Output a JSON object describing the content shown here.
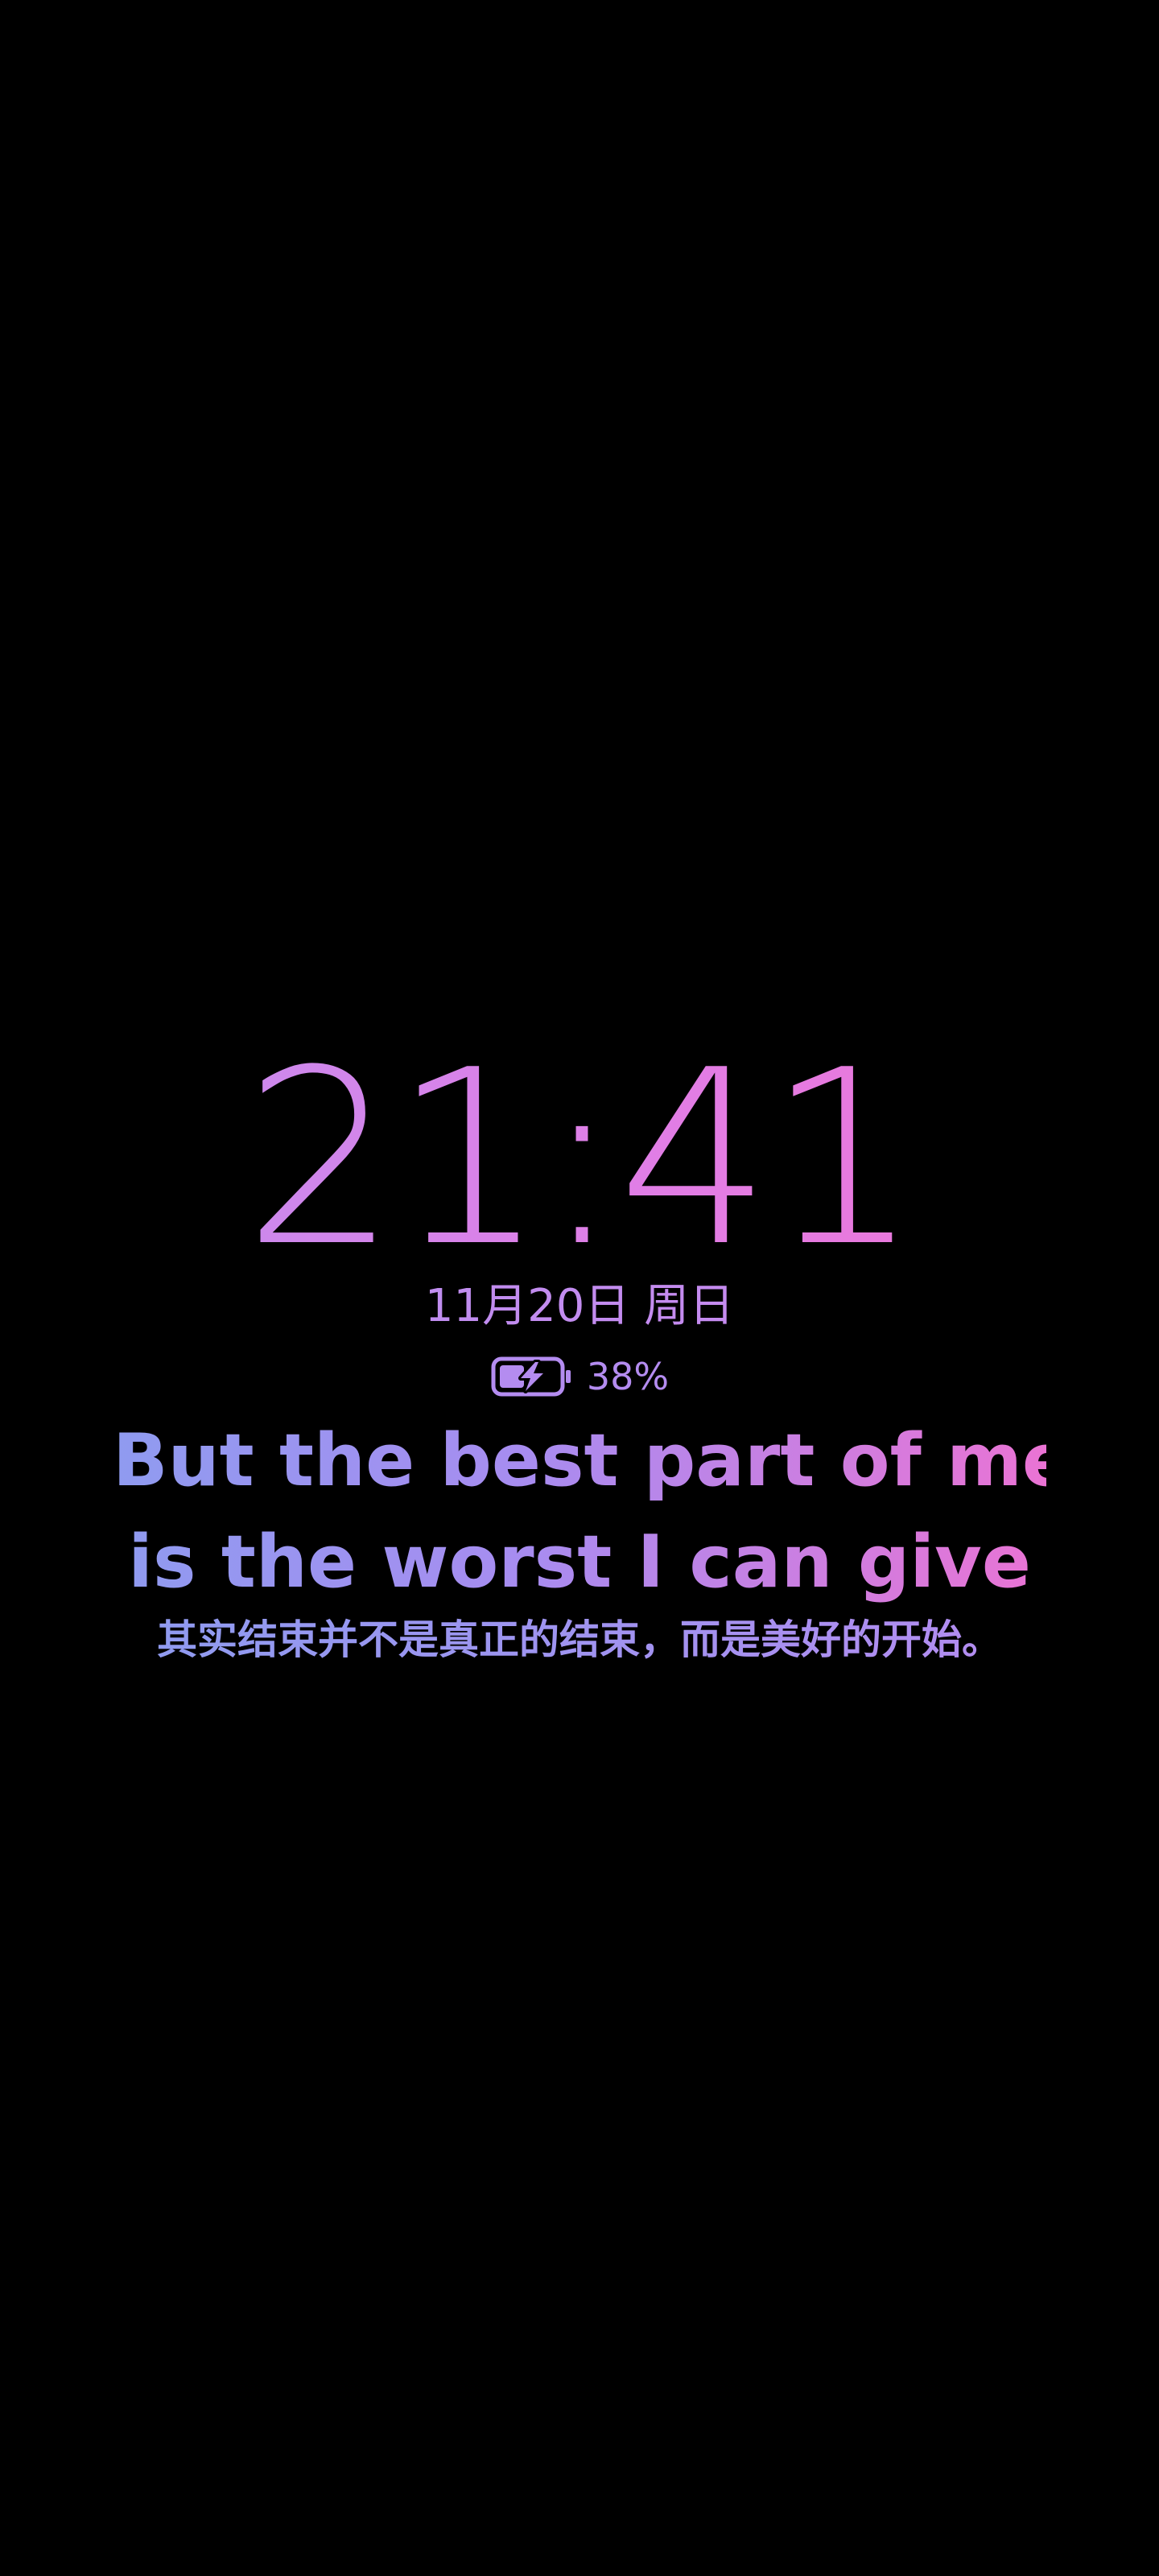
{
  "aod": {
    "time": "21:41",
    "date": "11月20日 周日",
    "battery": {
      "percent": "38%",
      "charging": true,
      "icon": "battery-charging-icon"
    },
    "quote": {
      "en_line_1": "But the best part of me",
      "en_line_2": "is the worst I can give",
      "zh": "其实结束并不是真正的结束，而是美好的开始。"
    }
  },
  "colors": {
    "background": "#000000",
    "gradient_start": "#8f9bf0",
    "gradient_mid": "#a88cf0",
    "gradient_end": "#ea73d4",
    "battery": "#b48cf0"
  }
}
